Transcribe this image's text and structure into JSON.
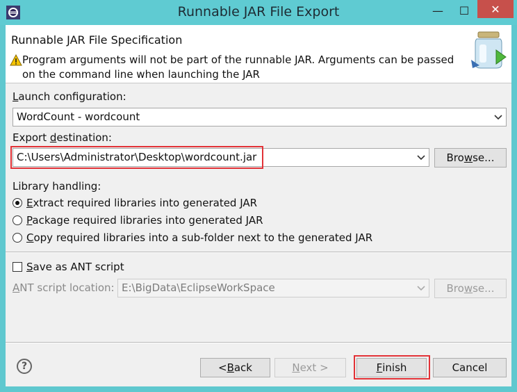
{
  "window": {
    "title": "Runnable JAR File Export",
    "minimize_glyph": "—",
    "maximize_glyph": "☐",
    "close_glyph": "✕"
  },
  "banner": {
    "title": "Runnable JAR File Specification",
    "message": "Program arguments will not be part of the runnable JAR. Arguments can be passed on the command line when launching the JAR",
    "icon": "jar-wizard-icon",
    "warning_icon": "warning-icon"
  },
  "launch": {
    "label_mnemonic": "L",
    "label_rest": "aunch configuration:",
    "value": "WordCount - wordcount"
  },
  "export": {
    "label_pre": "Export ",
    "label_mnemonic": "d",
    "label_rest": "estination:",
    "value": "C:\\Users\\Administrator\\Desktop\\wordcount.jar",
    "browse_mnemonic": "w",
    "browse_pre": "Bro",
    "browse_rest": "se..."
  },
  "library": {
    "label": "Library handling:",
    "options": [
      {
        "mnemonic": "E",
        "rest": "xtract required libraries into generated JAR",
        "checked": true
      },
      {
        "mnemonic": "P",
        "rest": "ackage required libraries into generated JAR",
        "checked": false
      },
      {
        "mnemonic": "C",
        "rest": "opy required libraries into a sub-folder next to the generated JAR",
        "checked": false
      }
    ]
  },
  "ant": {
    "checkbox_mnemonic": "S",
    "checkbox_rest": "ave as ANT script",
    "checked": false,
    "location_mnemonic": "A",
    "location_rest": "NT script location:",
    "location_value": "E:\\BigData\\EclipseWorkSpace",
    "browse_pre": "Bro",
    "browse_mnemonic": "w",
    "browse_rest": "se..."
  },
  "footer": {
    "help_glyph": "?",
    "back_pre": "< ",
    "back_mnemonic": "B",
    "back_rest": "ack",
    "next_mnemonic": "N",
    "next_rest": "ext >",
    "finish_mnemonic": "F",
    "finish_rest": "inish",
    "cancel": "Cancel"
  },
  "colors": {
    "titlebar": "#5fcbd2",
    "close": "#c7504b",
    "highlight": "#e23237"
  }
}
